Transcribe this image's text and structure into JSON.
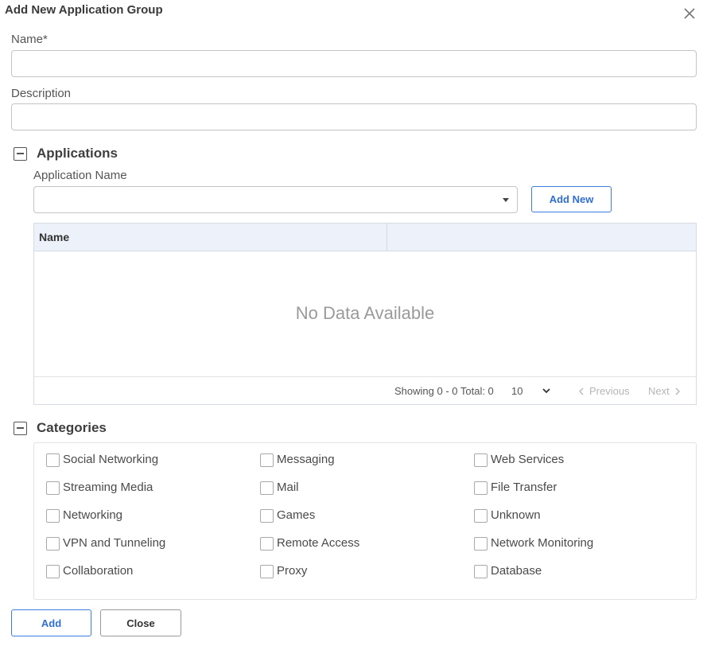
{
  "dialog": {
    "title": "Add New Application Group"
  },
  "form": {
    "name_label": "Name*",
    "name_value": "",
    "description_label": "Description",
    "description_value": ""
  },
  "applications": {
    "section_title": "Applications",
    "app_name_label": "Application Name",
    "app_name_selected": "",
    "add_new_label": "Add New",
    "table": {
      "columns": [
        "Name",
        ""
      ],
      "rows": [],
      "empty_text": "No Data Available",
      "showing_text": "Showing 0 - 0 Total: 0",
      "page_size": "10",
      "previous_label": "Previous",
      "next_label": "Next"
    }
  },
  "categories": {
    "section_title": "Categories",
    "items": [
      "Social Networking",
      "Messaging",
      "Web Services",
      "Streaming Media",
      "Mail",
      "File Transfer",
      "Networking",
      "Games",
      "Unknown",
      "VPN and Tunneling",
      "Remote Access",
      "Network Monitoring",
      "Collaboration",
      "Proxy",
      "Database"
    ]
  },
  "footer": {
    "add_label": "Add",
    "close_label": "Close"
  },
  "colors": {
    "accent": "#3b7ddd",
    "header_bg": "#edf2fa"
  },
  "icons": {
    "close": "close-icon",
    "collapse": "minus-square-icon",
    "dropdown": "caret-down-icon"
  }
}
